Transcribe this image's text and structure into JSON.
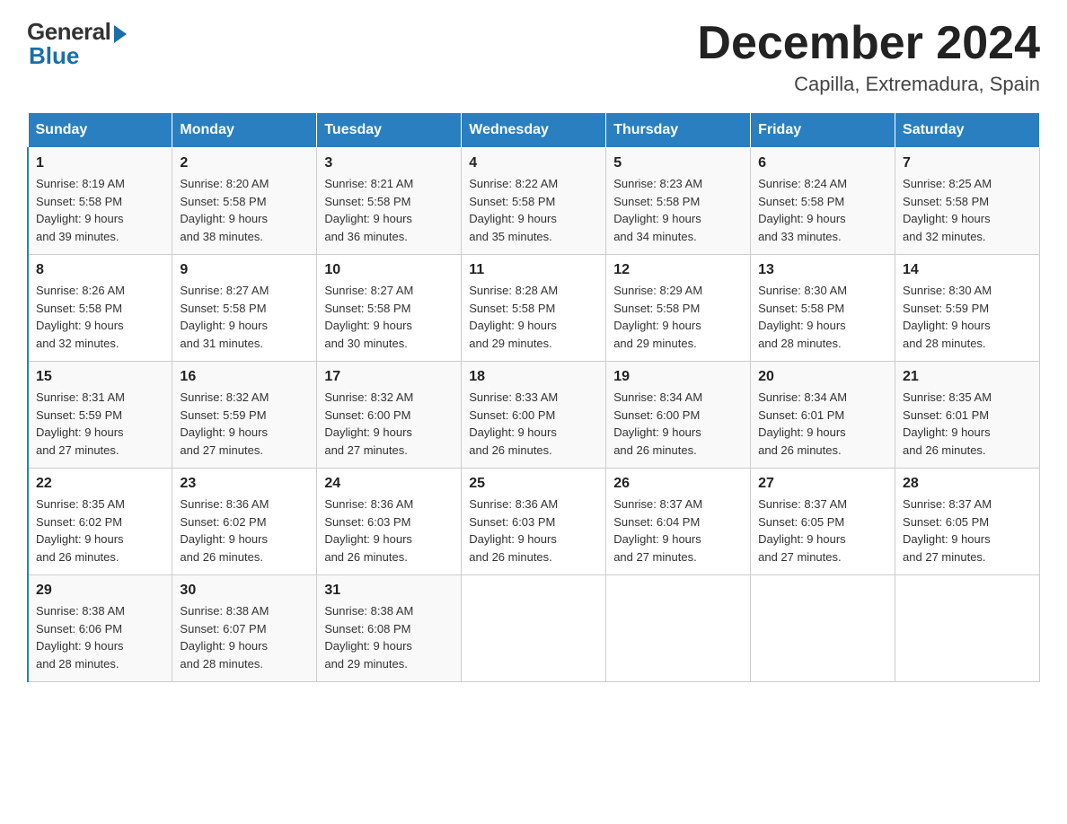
{
  "logo": {
    "general": "General",
    "blue": "Blue"
  },
  "title": {
    "month_year": "December 2024",
    "location": "Capilla, Extremadura, Spain"
  },
  "headers": [
    "Sunday",
    "Monday",
    "Tuesday",
    "Wednesday",
    "Thursday",
    "Friday",
    "Saturday"
  ],
  "weeks": [
    [
      {
        "day": "1",
        "info": "Sunrise: 8:19 AM\nSunset: 5:58 PM\nDaylight: 9 hours\nand 39 minutes."
      },
      {
        "day": "2",
        "info": "Sunrise: 8:20 AM\nSunset: 5:58 PM\nDaylight: 9 hours\nand 38 minutes."
      },
      {
        "day": "3",
        "info": "Sunrise: 8:21 AM\nSunset: 5:58 PM\nDaylight: 9 hours\nand 36 minutes."
      },
      {
        "day": "4",
        "info": "Sunrise: 8:22 AM\nSunset: 5:58 PM\nDaylight: 9 hours\nand 35 minutes."
      },
      {
        "day": "5",
        "info": "Sunrise: 8:23 AM\nSunset: 5:58 PM\nDaylight: 9 hours\nand 34 minutes."
      },
      {
        "day": "6",
        "info": "Sunrise: 8:24 AM\nSunset: 5:58 PM\nDaylight: 9 hours\nand 33 minutes."
      },
      {
        "day": "7",
        "info": "Sunrise: 8:25 AM\nSunset: 5:58 PM\nDaylight: 9 hours\nand 32 minutes."
      }
    ],
    [
      {
        "day": "8",
        "info": "Sunrise: 8:26 AM\nSunset: 5:58 PM\nDaylight: 9 hours\nand 32 minutes."
      },
      {
        "day": "9",
        "info": "Sunrise: 8:27 AM\nSunset: 5:58 PM\nDaylight: 9 hours\nand 31 minutes."
      },
      {
        "day": "10",
        "info": "Sunrise: 8:27 AM\nSunset: 5:58 PM\nDaylight: 9 hours\nand 30 minutes."
      },
      {
        "day": "11",
        "info": "Sunrise: 8:28 AM\nSunset: 5:58 PM\nDaylight: 9 hours\nand 29 minutes."
      },
      {
        "day": "12",
        "info": "Sunrise: 8:29 AM\nSunset: 5:58 PM\nDaylight: 9 hours\nand 29 minutes."
      },
      {
        "day": "13",
        "info": "Sunrise: 8:30 AM\nSunset: 5:58 PM\nDaylight: 9 hours\nand 28 minutes."
      },
      {
        "day": "14",
        "info": "Sunrise: 8:30 AM\nSunset: 5:59 PM\nDaylight: 9 hours\nand 28 minutes."
      }
    ],
    [
      {
        "day": "15",
        "info": "Sunrise: 8:31 AM\nSunset: 5:59 PM\nDaylight: 9 hours\nand 27 minutes."
      },
      {
        "day": "16",
        "info": "Sunrise: 8:32 AM\nSunset: 5:59 PM\nDaylight: 9 hours\nand 27 minutes."
      },
      {
        "day": "17",
        "info": "Sunrise: 8:32 AM\nSunset: 6:00 PM\nDaylight: 9 hours\nand 27 minutes."
      },
      {
        "day": "18",
        "info": "Sunrise: 8:33 AM\nSunset: 6:00 PM\nDaylight: 9 hours\nand 26 minutes."
      },
      {
        "day": "19",
        "info": "Sunrise: 8:34 AM\nSunset: 6:00 PM\nDaylight: 9 hours\nand 26 minutes."
      },
      {
        "day": "20",
        "info": "Sunrise: 8:34 AM\nSunset: 6:01 PM\nDaylight: 9 hours\nand 26 minutes."
      },
      {
        "day": "21",
        "info": "Sunrise: 8:35 AM\nSunset: 6:01 PM\nDaylight: 9 hours\nand 26 minutes."
      }
    ],
    [
      {
        "day": "22",
        "info": "Sunrise: 8:35 AM\nSunset: 6:02 PM\nDaylight: 9 hours\nand 26 minutes."
      },
      {
        "day": "23",
        "info": "Sunrise: 8:36 AM\nSunset: 6:02 PM\nDaylight: 9 hours\nand 26 minutes."
      },
      {
        "day": "24",
        "info": "Sunrise: 8:36 AM\nSunset: 6:03 PM\nDaylight: 9 hours\nand 26 minutes."
      },
      {
        "day": "25",
        "info": "Sunrise: 8:36 AM\nSunset: 6:03 PM\nDaylight: 9 hours\nand 26 minutes."
      },
      {
        "day": "26",
        "info": "Sunrise: 8:37 AM\nSunset: 6:04 PM\nDaylight: 9 hours\nand 27 minutes."
      },
      {
        "day": "27",
        "info": "Sunrise: 8:37 AM\nSunset: 6:05 PM\nDaylight: 9 hours\nand 27 minutes."
      },
      {
        "day": "28",
        "info": "Sunrise: 8:37 AM\nSunset: 6:05 PM\nDaylight: 9 hours\nand 27 minutes."
      }
    ],
    [
      {
        "day": "29",
        "info": "Sunrise: 8:38 AM\nSunset: 6:06 PM\nDaylight: 9 hours\nand 28 minutes."
      },
      {
        "day": "30",
        "info": "Sunrise: 8:38 AM\nSunset: 6:07 PM\nDaylight: 9 hours\nand 28 minutes."
      },
      {
        "day": "31",
        "info": "Sunrise: 8:38 AM\nSunset: 6:08 PM\nDaylight: 9 hours\nand 29 minutes."
      },
      {
        "day": "",
        "info": ""
      },
      {
        "day": "",
        "info": ""
      },
      {
        "day": "",
        "info": ""
      },
      {
        "day": "",
        "info": ""
      }
    ]
  ]
}
